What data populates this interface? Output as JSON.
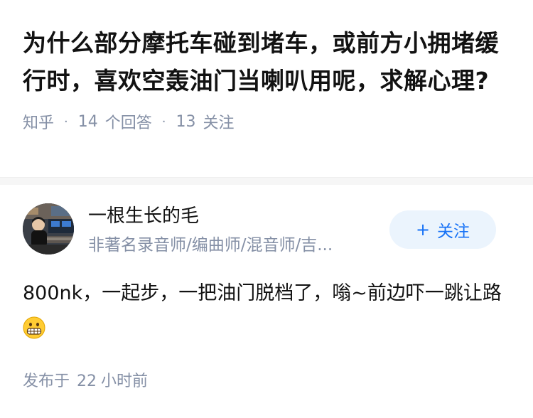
{
  "question": {
    "title": "为什么部分摩托车碰到堵车，或前方小拥堵缓行时，喜欢空轰油门当喇叭用呢，求解心理?",
    "source": "知乎",
    "answer_count": "14",
    "answer_label": "个回答",
    "follower_count": "13",
    "follower_label": "关注"
  },
  "author": {
    "name": "一根生长的毛",
    "bio": "非著名录音师/编曲师/混音师/吉...",
    "follow_plus": "+",
    "follow_label": "关注",
    "avatar_icon": "avatar-photo-studio",
    "follow_color": "#1772f6"
  },
  "answer": {
    "text": "800nk，一起步，一把油门脱档了，嗡~前边吓一跳让路",
    "emoji_icon": "grimacing-face-emoji"
  },
  "footer": {
    "published_label": "发布于",
    "time_value": "22",
    "time_unit": "小时前"
  }
}
